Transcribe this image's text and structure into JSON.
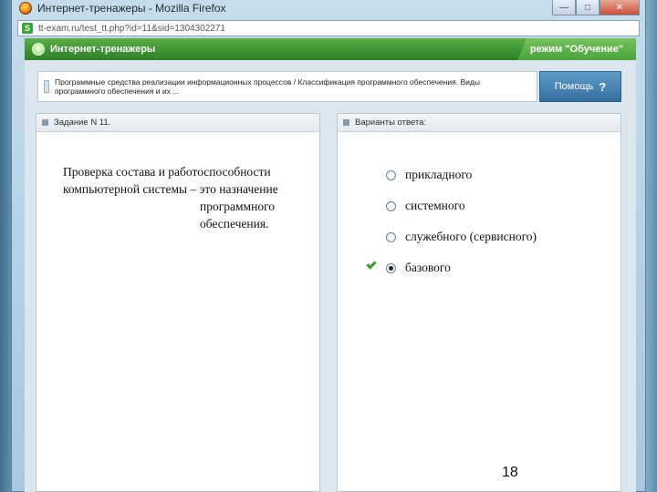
{
  "window": {
    "title": "Интернет-тренажеры - Mozilla Firefox",
    "url": "tt-exam.ru/test_tt.php?id=11&sid=1304302271",
    "controls": {
      "minimize": "—",
      "maximize": "□",
      "close": "✕"
    },
    "icons": {
      "browser": "firefox-icon",
      "site": "site-favicon"
    }
  },
  "app": {
    "title": "Интернет-тренажеры",
    "mode": "режим \"Обучение\"",
    "help_label": "Помощь",
    "help_icon": "?",
    "colors": {
      "header_green": "#3f9433",
      "help_blue": "#356fa0",
      "check_green": "#3b9b2f"
    }
  },
  "topic": {
    "text": "Программные средства реализации информационных процессов / Классификация программного обеспечения. Виды программного обеспечения и их ..."
  },
  "task": {
    "header": "Задание N 11.",
    "question_part1": "Проверка состава и работоспособности компьютерной системы – это назначение",
    "question_part2": "программного обеспечения."
  },
  "answers": {
    "header": "Варианты ответа:",
    "options": [
      {
        "label": "прикладного",
        "selected": false,
        "correct": false
      },
      {
        "label": "системного",
        "selected": false,
        "correct": false
      },
      {
        "label": "служебного (сервисного)",
        "selected": false,
        "correct": false
      },
      {
        "label": "базового",
        "selected": true,
        "correct": true
      }
    ]
  },
  "slide_number": "18"
}
